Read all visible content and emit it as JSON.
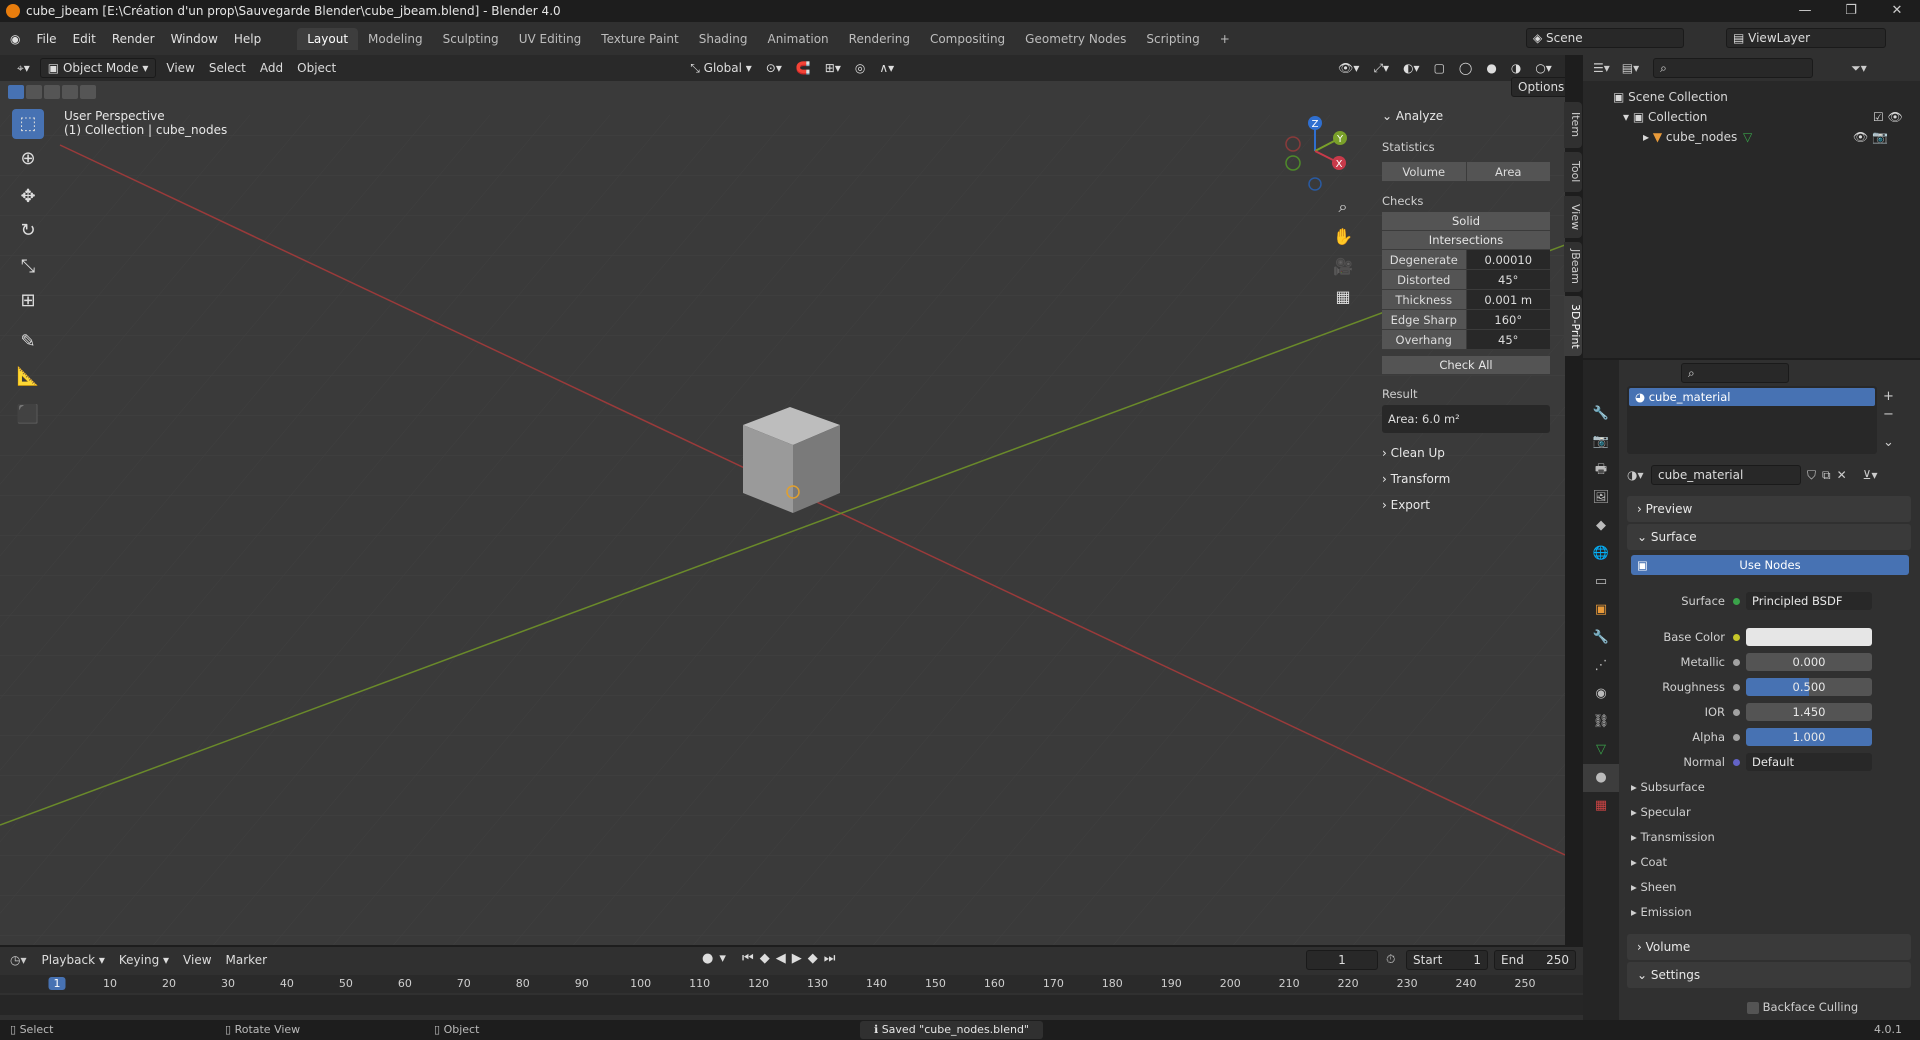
{
  "titlebar": {
    "title": "cube_jbeam [E:\\Création d'un prop\\Sauvegarde Blender\\cube_jbeam.blend] - Blender 4.0"
  },
  "menu": [
    "File",
    "Edit",
    "Render",
    "Window",
    "Help"
  ],
  "workspaces": [
    "Layout",
    "Modeling",
    "Sculpting",
    "UV Editing",
    "Texture Paint",
    "Shading",
    "Animation",
    "Rendering",
    "Compositing",
    "Geometry Nodes",
    "Scripting"
  ],
  "scene": "Scene",
  "viewlayer": "ViewLayer",
  "viewport": {
    "mode": "Object Mode",
    "menus": [
      "View",
      "Select",
      "Add",
      "Object"
    ],
    "orientation": "Global",
    "options": "Options",
    "perspective": "User Perspective",
    "collection": "(1) Collection | cube_nodes",
    "gizmo": {
      "z": "Z",
      "y": "Y",
      "x": "X"
    }
  },
  "sidetabs": [
    "Item",
    "Tool",
    "View",
    "JBeam",
    "3D-Print"
  ],
  "analyze": {
    "title": "Analyze",
    "statistics": "Statistics",
    "volume": "Volume",
    "area": "Area",
    "checks": "Checks",
    "solid": "Solid",
    "intersections": "Intersections",
    "rows": [
      {
        "label": "Degenerate",
        "value": "0.00010"
      },
      {
        "label": "Distorted",
        "value": "45°"
      },
      {
        "label": "Thickness",
        "value": "0.001 m"
      },
      {
        "label": "Edge Sharp",
        "value": "160°"
      },
      {
        "label": "Overhang",
        "value": "45°"
      }
    ],
    "check_all": "Check All",
    "result_label": "Result",
    "result": "Area: 6.0 m²",
    "sections": [
      "Clean Up",
      "Transform",
      "Export"
    ]
  },
  "outliner": {
    "scene_collection": "Scene Collection",
    "collection": "Collection",
    "object": "cube_nodes"
  },
  "material": {
    "slot": "cube_material",
    "name": "cube_material",
    "preview": "Preview",
    "surface_section": "Surface",
    "use_nodes": "Use Nodes",
    "rows": [
      {
        "label": "Surface",
        "value": "Principled BSDF",
        "kind": "text",
        "dot": "#3aa34a"
      },
      {
        "label": "Base Color",
        "value": "",
        "kind": "color",
        "dot": "#c7c729"
      },
      {
        "label": "Metallic",
        "value": "0.000",
        "kind": "num",
        "fill": 0,
        "dot": "#a1a1a1"
      },
      {
        "label": "Roughness",
        "value": "0.500",
        "kind": "num",
        "fill": 0.5,
        "dot": "#a1a1a1"
      },
      {
        "label": "IOR",
        "value": "1.450",
        "kind": "num",
        "fill": 0,
        "dot": "#a1a1a1"
      },
      {
        "label": "Alpha",
        "value": "1.000",
        "kind": "num",
        "fill": 1,
        "dot": "#a1a1a1"
      },
      {
        "label": "Normal",
        "value": "Default",
        "kind": "text",
        "dot": "#6363c7"
      }
    ],
    "subpanels": [
      "Subsurface",
      "Specular",
      "Transmission",
      "Coat",
      "Sheen",
      "Emission"
    ],
    "volume": "Volume",
    "settings": "Settings",
    "backface": "Backface Culling"
  },
  "timeline": {
    "menus": [
      "Playback",
      "Keying",
      "View",
      "Marker"
    ],
    "current": "1",
    "start_label": "Start",
    "start": "1",
    "end_label": "End",
    "end": "250",
    "ticks": [
      "1",
      "10",
      "20",
      "30",
      "40",
      "50",
      "60",
      "70",
      "80",
      "90",
      "100",
      "110",
      "120",
      "130",
      "140",
      "150",
      "160",
      "170",
      "180",
      "190",
      "200",
      "210",
      "220",
      "230",
      "240",
      "250"
    ]
  },
  "status": {
    "select": "Select",
    "rotate": "Rotate View",
    "object": "Object",
    "message": "Saved \"cube_nodes.blend\"",
    "version": "4.0.1"
  }
}
